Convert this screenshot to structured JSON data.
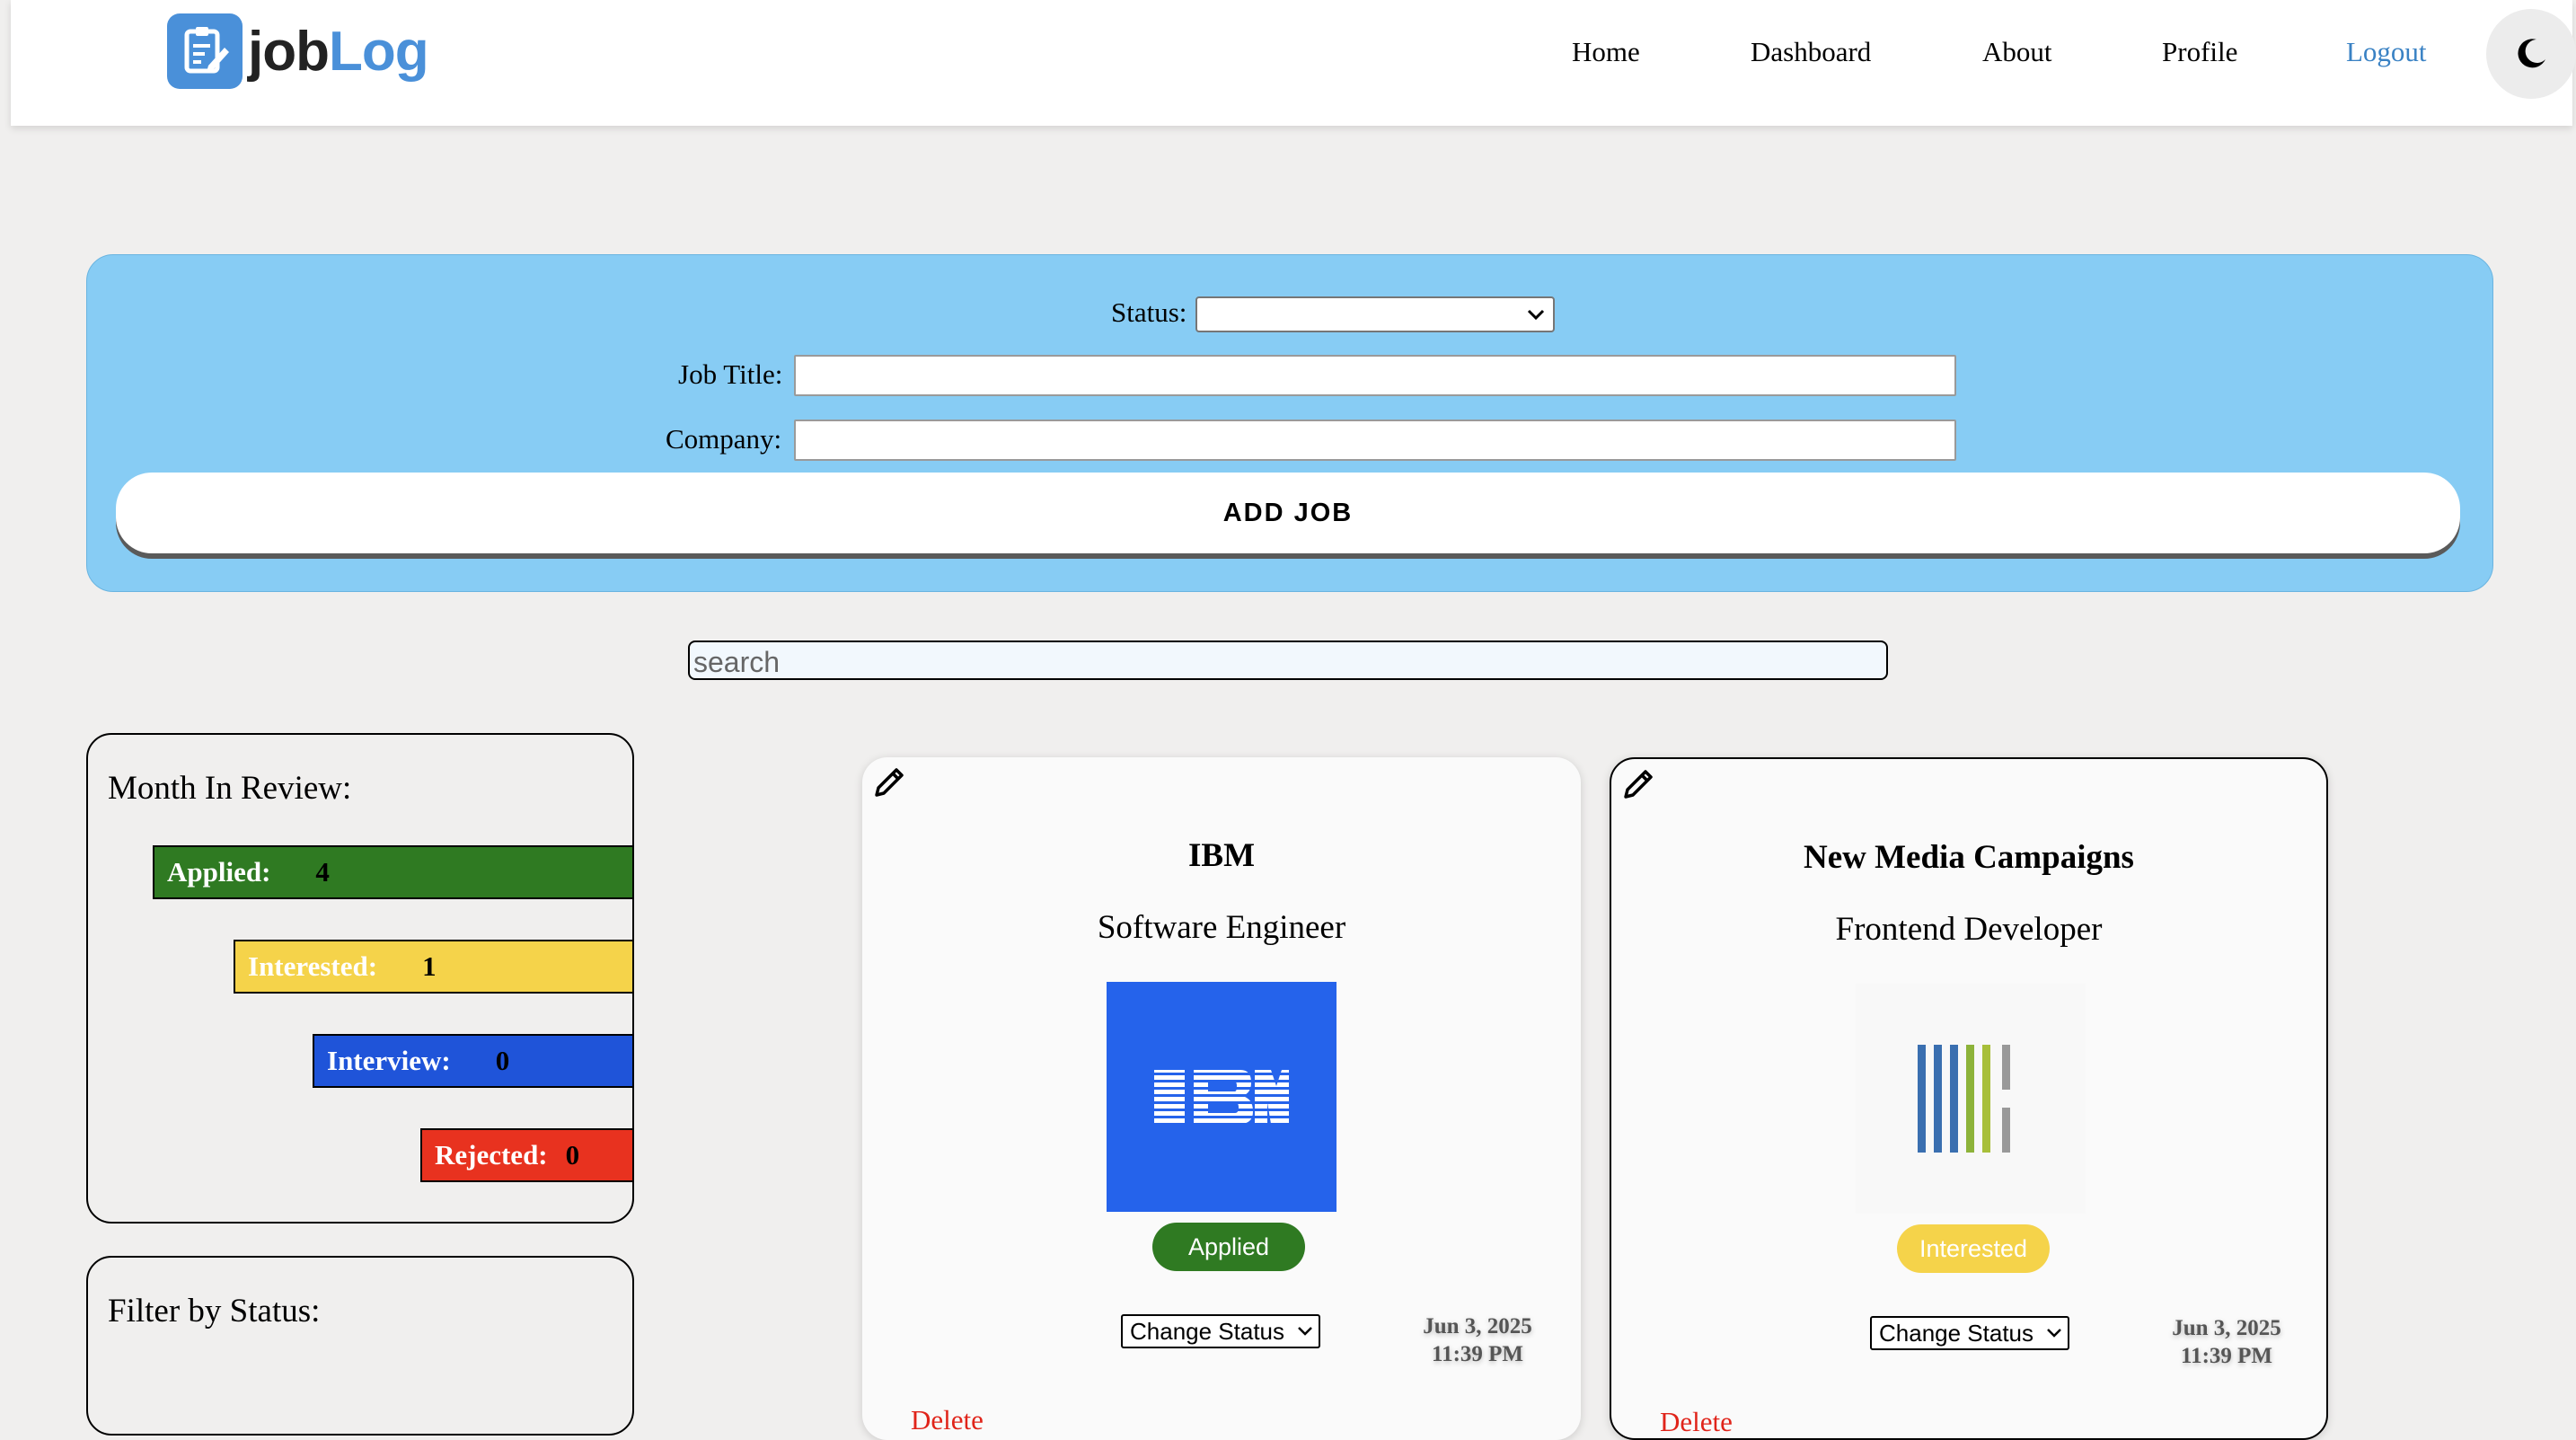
{
  "app": {
    "logo_prefix": "job",
    "logo_suffix": "Log"
  },
  "nav": {
    "home": "Home",
    "dashboard": "Dashboard",
    "about": "About",
    "profile": "Profile",
    "logout": "Logout",
    "theme_icon": "moon-icon"
  },
  "form": {
    "status_label": "Status:",
    "status_value": "",
    "job_title_label": "Job Title:",
    "job_title_value": "",
    "company_label": "Company:",
    "company_value": "",
    "submit_label": "ADD JOB"
  },
  "search": {
    "placeholder": "search"
  },
  "review": {
    "title": "Month In Review:",
    "stats": [
      {
        "label": "Applied:",
        "value": "4",
        "color": "#2f7a22"
      },
      {
        "label": "Interested:",
        "value": "1",
        "color": "#f5d34a"
      },
      {
        "label": "Interview:",
        "value": "0",
        "color": "#1f54d9"
      },
      {
        "label": "Rejected:",
        "value": "0",
        "color": "#e8321f"
      }
    ]
  },
  "filter": {
    "title": "Filter by Status:"
  },
  "jobs": [
    {
      "company": "IBM",
      "title": "Software Engineer",
      "logo_icon": "ibm-logo",
      "status": "Applied",
      "status_color": "#2f7a22",
      "change_status_label": "Change Status",
      "date": "Jun 3, 2025",
      "time": "11:39 PM",
      "delete_label": "Delete"
    },
    {
      "company": "New Media Campaigns",
      "title": "Frontend Developer",
      "logo_icon": "new-media-campaigns-logo",
      "status": "Interested",
      "status_color": "#f5d34a",
      "change_status_label": "Change Status",
      "date": "Jun 3, 2025",
      "time": "11:39 PM",
      "delete_label": "Delete"
    }
  ]
}
